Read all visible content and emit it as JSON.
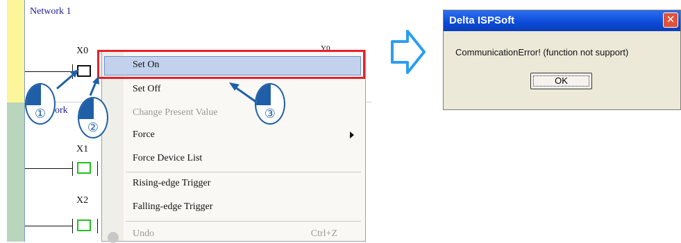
{
  "ladder": {
    "network1_label": "Network 1",
    "network2_label_partial": "vork",
    "contacts": [
      "X0",
      "X1",
      "X2"
    ],
    "coil_label_partial": "Y0"
  },
  "context_menu": {
    "items": [
      {
        "label": "Set On",
        "state": "highlighted"
      },
      {
        "label": "Set Off",
        "state": "enabled"
      },
      {
        "label": "Change Present Value",
        "state": "disabled"
      },
      {
        "label": "Force",
        "state": "enabled",
        "submenu": true
      },
      {
        "label": "Force Device List",
        "state": "enabled"
      },
      {
        "label": "Rising-edge Trigger",
        "state": "enabled"
      },
      {
        "label": "Falling-edge Trigger",
        "state": "enabled"
      },
      {
        "label": "Undo",
        "state": "disabled",
        "shortcut": "Ctrl+Z"
      }
    ]
  },
  "steps": [
    "①",
    "②",
    "③"
  ],
  "dialog": {
    "title": "Delta ISPSoft",
    "close_glyph": "✕",
    "message": "CommunicationError! (function not support)",
    "ok_label": "OK"
  },
  "colors": {
    "highlight_frame": "#e8202a",
    "step_badge": "#1f5fa8",
    "contact_green": "#21c021",
    "dialog_titlebar": "#0b4ad8",
    "big_arrow": "#2a9ef0"
  }
}
